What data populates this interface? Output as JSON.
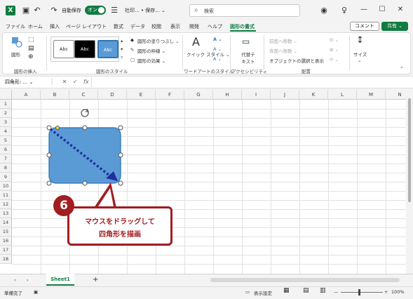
{
  "titlebar": {
    "autosave_label": "自動保存",
    "autosave_state": "オン",
    "doc_title": "社印... • 保存... ⌄",
    "search_placeholder": "検索"
  },
  "tabs": [
    {
      "label": "ファイル"
    },
    {
      "label": "ホーム"
    },
    {
      "label": "挿入"
    },
    {
      "label": "ページ レイアウト"
    },
    {
      "label": "数式"
    },
    {
      "label": "データ"
    },
    {
      "label": "校閲"
    },
    {
      "label": "表示"
    },
    {
      "label": "開発"
    },
    {
      "label": "ヘルプ"
    },
    {
      "label": "図形の書式"
    }
  ],
  "header_buttons": {
    "comment": "コメント",
    "share": "共有 ⌄"
  },
  "ribbon": {
    "shape_label": "図形",
    "group_insert": "図形の挿入",
    "style_labels": [
      "Abc",
      "Abc",
      "Abc"
    ],
    "group_styles": "図形のスタイル",
    "fill": "図形の塗りつぶし ⌄",
    "outline": "図形の枠線 ⌄",
    "effects": "図形の効果 ⌄",
    "quick_style": "クイック スタイル ⌄",
    "group_wordart": "ワードアートのスタイル",
    "alt_text": "代替テ キスト",
    "group_accessibility": "アクセシビリティ",
    "bring_forward": "前面へ移動 ⌄",
    "send_backward": "背面へ移動 ⌄",
    "selection_pane": "オブジェクトの選択と表示",
    "group_arrange": "配置",
    "size": "サイズ"
  },
  "formula_bar": {
    "name_box": "四角形: ... ⌄",
    "fx": "fx"
  },
  "grid": {
    "columns": [
      "A",
      "B",
      "C",
      "D",
      "E",
      "F",
      "G",
      "H",
      "I",
      "J",
      "K",
      "L",
      "M",
      "N"
    ],
    "rows": [
      "1",
      "2",
      "3",
      "4",
      "5",
      "6",
      "7",
      "8",
      "9",
      "10",
      "11",
      "12",
      "13",
      "14",
      "15",
      "16",
      "17",
      "18"
    ]
  },
  "sheet_tab": "Sheet1",
  "add_sheet": "+",
  "status": {
    "ready": "準備完了",
    "display_settings": "表示設定",
    "zoom": "100%"
  },
  "callout": {
    "step": "6",
    "line1": "マウスをドラッグして",
    "line2": "四角形を描画"
  },
  "colors": {
    "accent": "#107c41",
    "shape_fill": "#5b9bd5",
    "shape_stroke": "#2e75b6",
    "callout": "#a11d22",
    "arrow": "#1f2f9e"
  }
}
